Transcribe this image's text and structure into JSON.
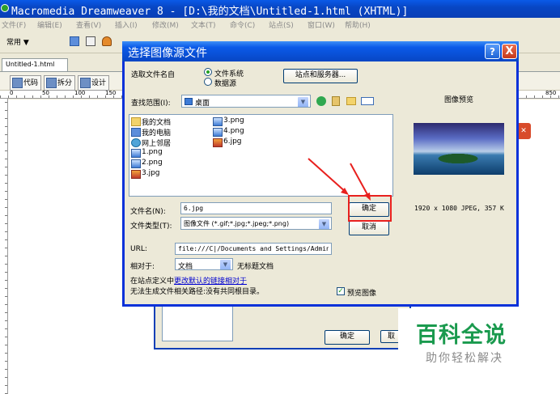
{
  "app": {
    "title": "Macromedia Dreamweaver 8 - [D:\\我的文档\\Untitled-1.html (XHTML)]",
    "menu": [
      "文件(F)",
      "编辑(E)",
      "查看(V)",
      "插入(I)",
      "修改(M)",
      "文本(T)",
      "命令(C)",
      "站点(S)",
      "窗口(W)",
      "帮助(H)"
    ],
    "toolbar_category": "常用 ▼",
    "document_tab": "Untitled-1.html",
    "view_buttons": [
      "代码",
      "拆分",
      "设计"
    ],
    "ruler_marks": [
      "0",
      "50",
      "100",
      "150",
      "850"
    ]
  },
  "under_dialog": {
    "ok_label": "确定",
    "cancel_label": "取"
  },
  "dialog": {
    "title": "选择图像源文件",
    "help_label": "?",
    "close_label": "X",
    "select_name_from_label": "选取文件名自",
    "radio_filesystem": "文件系统",
    "radio_datasource": "数据源",
    "site_server_button": "站点和服务器...",
    "look_in_label": "查找范围(I):",
    "look_in_value": "桌面",
    "files": [
      {
        "name": "我的文档",
        "icon": "folder-icon"
      },
      {
        "name": "我的电脑",
        "icon": "computer-icon"
      },
      {
        "name": "网上邻居",
        "icon": "network-icon"
      },
      {
        "name": "1.png",
        "icon": "png-icon"
      },
      {
        "name": "2.png",
        "icon": "png-icon"
      },
      {
        "name": "3.jpg",
        "icon": "jpg-icon"
      },
      {
        "name": "3.png",
        "icon": "png-icon"
      },
      {
        "name": "4.png",
        "icon": "png-icon"
      },
      {
        "name": "6.jpg",
        "icon": "jpg-icon"
      }
    ],
    "preview_title": "图像预览",
    "preview_info": "1920 x 1080 JPEG, 357 K",
    "filename_label": "文件名(N):",
    "filename_value": "6.jpg",
    "filetype_label": "文件类型(T):",
    "filetype_value": "图像文件 (*.gif;*.jpg;*.jpeg;*.png)",
    "ok_button": "确定",
    "cancel_button": "取消",
    "url_label": "URL:",
    "url_value": "file:///C|/Documents and Settings/Admini:",
    "relative_label": "相对于:",
    "relative_value": "文档",
    "untitled_doc": "无标题文档",
    "site_def_prefix": "在站点定义中",
    "site_def_link": "更改默认的链接相对于",
    "warning_text": "无法生成文件相关路径:没有共同根目录。",
    "preview_checkbox": "预览图像"
  },
  "watermark": {
    "title": "百科全说",
    "subtitle": "助你轻松解决"
  },
  "colors": {
    "xp_blue": "#0a5ae8",
    "annotation_red": "#e8201e",
    "watermark_green": "#1a9a4e"
  }
}
